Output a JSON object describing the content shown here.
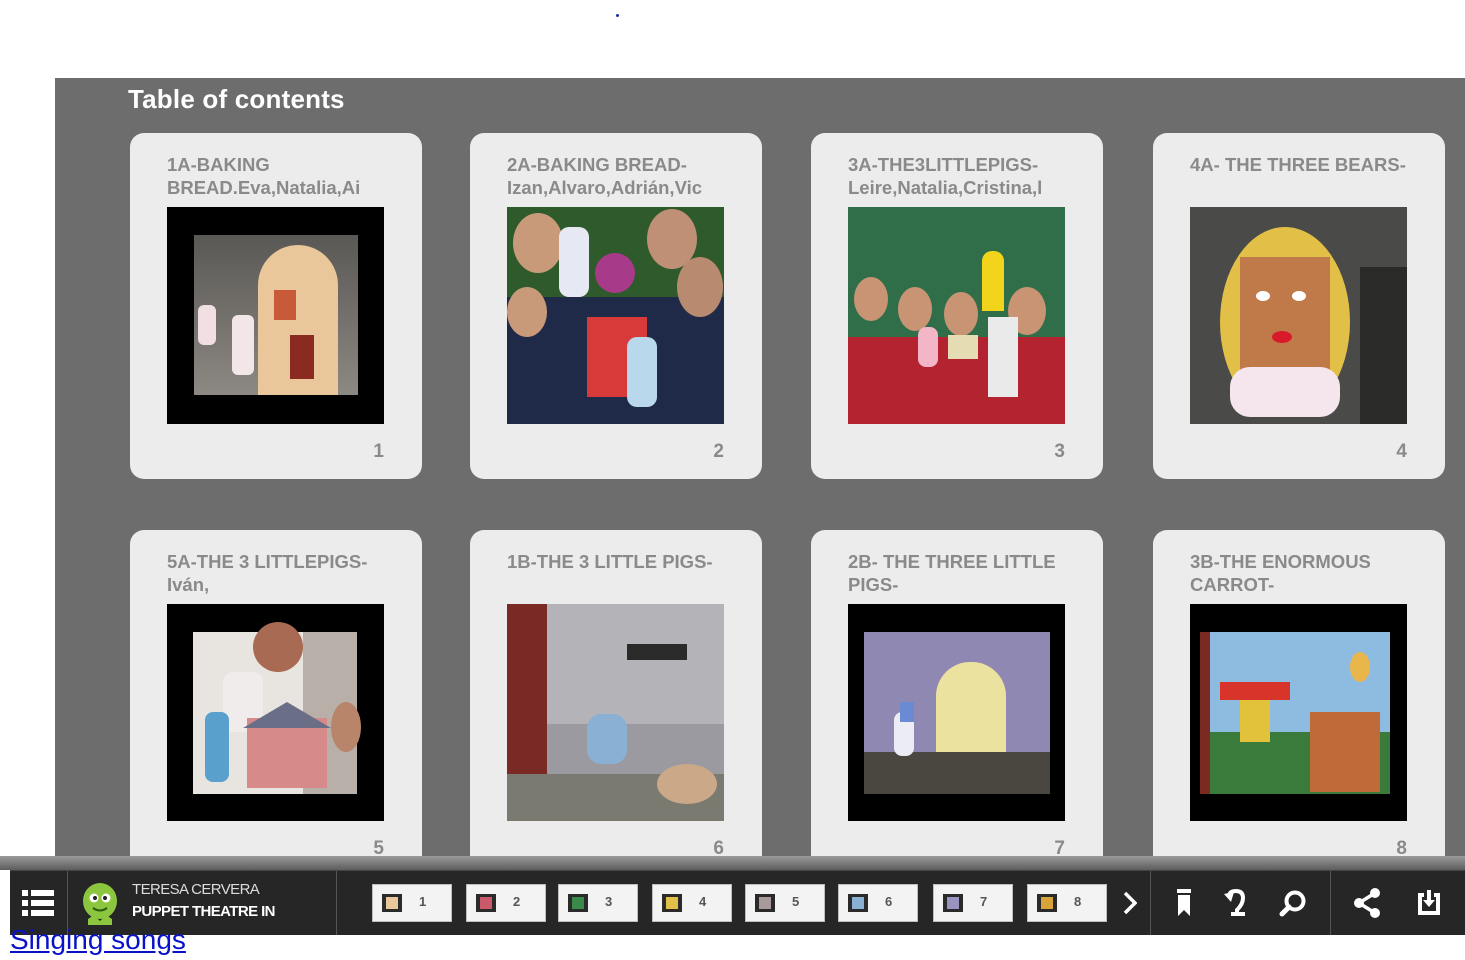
{
  "toc": {
    "title": "Table of contents"
  },
  "cards": [
    {
      "title": "1A-BAKING BREAD.Eva,Natalia,Ai",
      "page": "1"
    },
    {
      "title": "2A-BAKING BREAD- Izan,Alvaro,Adrián,Vic",
      "page": "2"
    },
    {
      "title": "3A-THE3LITTLEPIGS- Leire,Natalia,Cristina,l",
      "page": "3"
    },
    {
      "title": "4A- THE THREE BEARS-",
      "page": "4"
    },
    {
      "title": "5A-THE 3 LITTLEPIGS-Iván,",
      "page": "5"
    },
    {
      "title": "1B-THE 3 LITTLE PIGS-",
      "page": "6"
    },
    {
      "title": "2B- THE THREE LITTLE PIGS-",
      "page": "7"
    },
    {
      "title": "3B-THE ENORMOUS CARROT-",
      "page": "8"
    }
  ],
  "toolbar": {
    "author": "TERESA CERVERA",
    "book_title": "PUPPET THEATRE IN",
    "pages": [
      "1",
      "2",
      "3",
      "4",
      "5",
      "6",
      "7",
      "8"
    ],
    "icons": [
      "menu-icon",
      "next-arrow-icon",
      "bookmark-icon",
      "rotate-icon",
      "zoom-icon",
      "share-icon",
      "download-icon"
    ]
  },
  "link": {
    "text": "Singing songs"
  }
}
